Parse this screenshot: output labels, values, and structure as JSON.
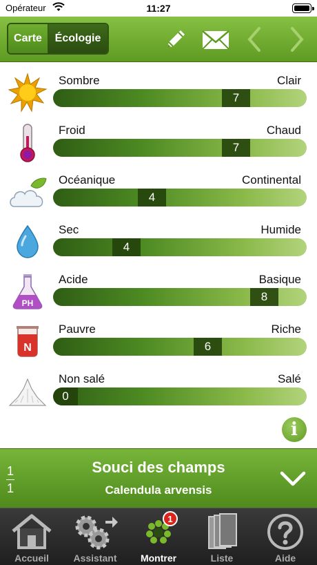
{
  "status_bar": {
    "carrier": "Opérateur",
    "time": "11:27"
  },
  "toolbar": {
    "segments": [
      "Carte",
      "Écologie"
    ],
    "selected_segment": "Écologie",
    "icons": [
      "pencil-icon",
      "envelope-icon",
      "chevron-left-icon",
      "chevron-right-icon"
    ]
  },
  "ecology": [
    {
      "left": "Sombre",
      "right": "Clair",
      "value": "7",
      "icon": "sun-icon"
    },
    {
      "left": "Froid",
      "right": "Chaud",
      "value": "7",
      "icon": "thermometer-icon"
    },
    {
      "left": "Océanique",
      "right": "Continental",
      "value": "4",
      "icon": "cloud-leaf-icon"
    },
    {
      "left": "Sec",
      "right": "Humide",
      "value": "4",
      "icon": "water-drop-icon"
    },
    {
      "left": "Acide",
      "right": "Basique",
      "value": "8",
      "icon": "flask-ph-icon",
      "icon_text": "PH"
    },
    {
      "left": "Pauvre",
      "right": "Riche",
      "value": "6",
      "icon": "beaker-n-icon",
      "icon_text": "N"
    },
    {
      "left": "Non salé",
      "right": "Salé",
      "value": "0",
      "icon": "salt-pile-icon"
    }
  ],
  "species": {
    "index": "1",
    "total": "1",
    "common_name": "Souci des champs",
    "latin_name": "Calendula arvensis"
  },
  "tabs": [
    {
      "label": "Accueil",
      "icon": "home-icon"
    },
    {
      "label": "Assistant",
      "icon": "gears-icon"
    },
    {
      "label": "Montrer",
      "icon": "flower-icon",
      "badge": "1",
      "active": true
    },
    {
      "label": "Liste",
      "icon": "books-icon"
    },
    {
      "label": "Aide",
      "icon": "help-icon"
    }
  ],
  "colors": {
    "accent_green": "#6aa82c",
    "dark_green": "#2a4c10",
    "tab_bar": "#2b2b2b",
    "badge_red": "#d9251b"
  }
}
